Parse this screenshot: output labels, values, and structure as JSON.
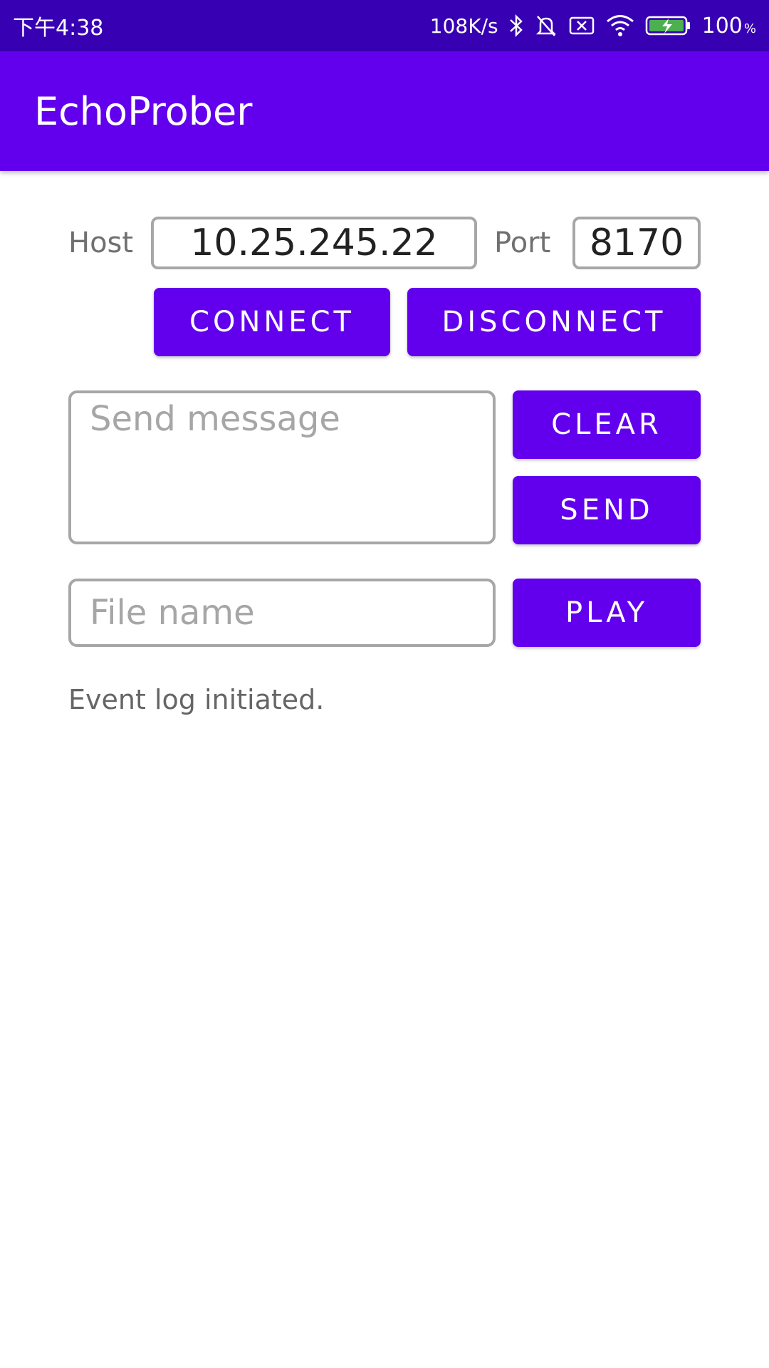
{
  "status_bar": {
    "time": "下午4:38",
    "network_speed": "108K/s",
    "battery_percent": "100",
    "battery_unit": "%",
    "icons": [
      "bluetooth-icon",
      "bell-off-icon",
      "sim-off-icon",
      "wifi-icon",
      "battery-charging-icon"
    ]
  },
  "app_bar": {
    "title": "EchoProber"
  },
  "connection": {
    "host_label": "Host",
    "host_value": "10.25.245.22",
    "port_label": "Port",
    "port_value": "8170",
    "connect_label": "CONNECT",
    "disconnect_label": "DISCONNECT"
  },
  "message": {
    "placeholder": "Send message",
    "value": "",
    "clear_label": "CLEAR",
    "send_label": "SEND"
  },
  "file": {
    "placeholder": "File name",
    "value": "",
    "play_label": "PLAY"
  },
  "log": {
    "text": "Event log initiated."
  },
  "colors": {
    "primary": "#6200ee",
    "primary_dark": "#3700b3",
    "border": "#a7a7a7",
    "label": "#707070"
  }
}
